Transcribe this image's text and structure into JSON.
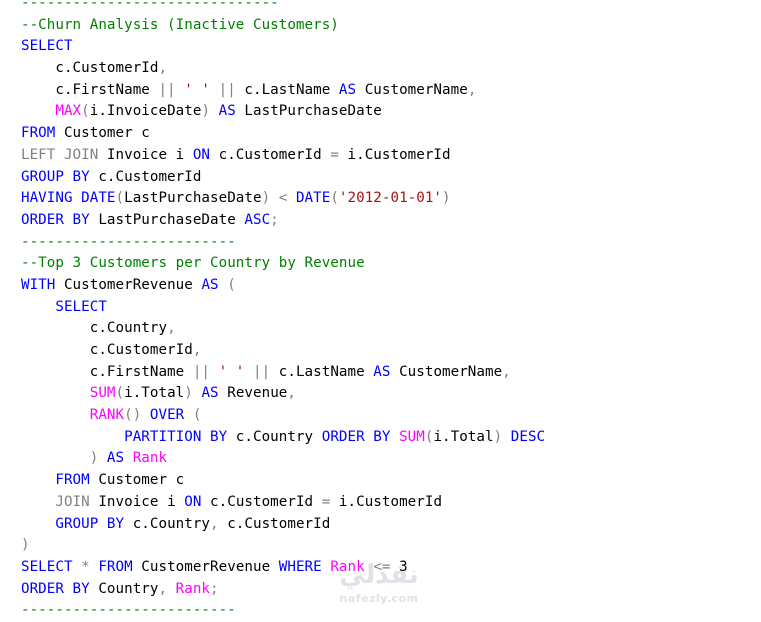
{
  "colors": {
    "comment": "#008000",
    "keyword": "#0000ff",
    "function": "#ff00ff",
    "string": "#a31515",
    "operator": "#808080",
    "text": "#000000"
  },
  "editor": {
    "lines": [
      [
        [
          "comment",
          "------------------------------"
        ]
      ],
      [
        [
          "comment",
          "--Churn Analysis (Inactive Customers)"
        ]
      ],
      [
        [
          "keyword",
          "SELECT"
        ]
      ],
      [
        [
          "text",
          "    c.CustomerId"
        ],
        [
          "operator",
          ","
        ]
      ],
      [
        [
          "text",
          "    c.FirstName "
        ],
        [
          "operator",
          "||"
        ],
        [
          "text",
          " "
        ],
        [
          "string",
          "' '"
        ],
        [
          "text",
          " "
        ],
        [
          "operator",
          "||"
        ],
        [
          "text",
          " c.LastName "
        ],
        [
          "keyword",
          "AS"
        ],
        [
          "text",
          " CustomerName"
        ],
        [
          "operator",
          ","
        ]
      ],
      [
        [
          "text",
          "    "
        ],
        [
          "function",
          "MAX"
        ],
        [
          "operator",
          "("
        ],
        [
          "text",
          "i.InvoiceDate"
        ],
        [
          "operator",
          ")"
        ],
        [
          "text",
          " "
        ],
        [
          "keyword",
          "AS"
        ],
        [
          "text",
          " LastPurchaseDate"
        ]
      ],
      [
        [
          "keyword",
          "FROM"
        ],
        [
          "text",
          " Customer c"
        ]
      ],
      [
        [
          "operator",
          "LEFT JOIN"
        ],
        [
          "text",
          " Invoice i "
        ],
        [
          "keyword",
          "ON"
        ],
        [
          "text",
          " c.CustomerId "
        ],
        [
          "operator",
          "="
        ],
        [
          "text",
          " i.CustomerId"
        ]
      ],
      [
        [
          "keyword",
          "GROUP BY"
        ],
        [
          "text",
          " c.CustomerId"
        ]
      ],
      [
        [
          "keyword",
          "HAVING DATE"
        ],
        [
          "operator",
          "("
        ],
        [
          "text",
          "LastPurchaseDate"
        ],
        [
          "operator",
          ")"
        ],
        [
          "text",
          " "
        ],
        [
          "operator",
          "<"
        ],
        [
          "text",
          " "
        ],
        [
          "keyword",
          "DATE"
        ],
        [
          "operator",
          "("
        ],
        [
          "string",
          "'2012-01-01'"
        ],
        [
          "operator",
          ")"
        ]
      ],
      [
        [
          "keyword",
          "ORDER BY"
        ],
        [
          "text",
          " LastPurchaseDate "
        ],
        [
          "keyword",
          "ASC"
        ],
        [
          "operator",
          ";"
        ]
      ],
      [
        [
          "comment",
          "-------------------------"
        ]
      ],
      [
        [
          "comment",
          "--Top 3 Customers per Country by Revenue"
        ]
      ],
      [
        [
          "keyword",
          "WITH"
        ],
        [
          "text",
          " CustomerRevenue "
        ],
        [
          "keyword",
          "AS"
        ],
        [
          "text",
          " "
        ],
        [
          "operator",
          "("
        ]
      ],
      [
        [
          "text",
          "    "
        ],
        [
          "keyword",
          "SELECT"
        ]
      ],
      [
        [
          "text",
          "        c.Country"
        ],
        [
          "operator",
          ","
        ]
      ],
      [
        [
          "text",
          "        c.CustomerId"
        ],
        [
          "operator",
          ","
        ]
      ],
      [
        [
          "text",
          "        c.FirstName "
        ],
        [
          "operator",
          "||"
        ],
        [
          "text",
          " "
        ],
        [
          "string",
          "' '"
        ],
        [
          "text",
          " "
        ],
        [
          "operator",
          "||"
        ],
        [
          "text",
          " c.LastName "
        ],
        [
          "keyword",
          "AS"
        ],
        [
          "text",
          " CustomerName"
        ],
        [
          "operator",
          ","
        ]
      ],
      [
        [
          "text",
          "        "
        ],
        [
          "function",
          "SUM"
        ],
        [
          "operator",
          "("
        ],
        [
          "text",
          "i.Total"
        ],
        [
          "operator",
          ")"
        ],
        [
          "text",
          " "
        ],
        [
          "keyword",
          "AS"
        ],
        [
          "text",
          " Revenue"
        ],
        [
          "operator",
          ","
        ]
      ],
      [
        [
          "text",
          "        "
        ],
        [
          "function",
          "RANK"
        ],
        [
          "operator",
          "()"
        ],
        [
          "text",
          " "
        ],
        [
          "keyword",
          "OVER"
        ],
        [
          "text",
          " "
        ],
        [
          "operator",
          "("
        ]
      ],
      [
        [
          "text",
          "            "
        ],
        [
          "keyword",
          "PARTITION BY"
        ],
        [
          "text",
          " c.Country "
        ],
        [
          "keyword",
          "ORDER BY"
        ],
        [
          "text",
          " "
        ],
        [
          "function",
          "SUM"
        ],
        [
          "operator",
          "("
        ],
        [
          "text",
          "i.Total"
        ],
        [
          "operator",
          ")"
        ],
        [
          "text",
          " "
        ],
        [
          "keyword",
          "DESC"
        ]
      ],
      [
        [
          "text",
          "        "
        ],
        [
          "operator",
          ")"
        ],
        [
          "text",
          " "
        ],
        [
          "keyword",
          "AS"
        ],
        [
          "text",
          " "
        ],
        [
          "function",
          "Rank"
        ]
      ],
      [
        [
          "text",
          "    "
        ],
        [
          "keyword",
          "FROM"
        ],
        [
          "text",
          " Customer c"
        ]
      ],
      [
        [
          "text",
          "    "
        ],
        [
          "operator",
          "JOIN"
        ],
        [
          "text",
          " Invoice i "
        ],
        [
          "keyword",
          "ON"
        ],
        [
          "text",
          " c.CustomerId "
        ],
        [
          "operator",
          "="
        ],
        [
          "text",
          " i.CustomerId"
        ]
      ],
      [
        [
          "text",
          "    "
        ],
        [
          "keyword",
          "GROUP BY"
        ],
        [
          "text",
          " c.Country"
        ],
        [
          "operator",
          ","
        ],
        [
          "text",
          " c.CustomerId"
        ]
      ],
      [
        [
          "operator",
          ")"
        ]
      ],
      [
        [
          "keyword",
          "SELECT"
        ],
        [
          "text",
          " "
        ],
        [
          "operator",
          "*"
        ],
        [
          "text",
          " "
        ],
        [
          "keyword",
          "FROM"
        ],
        [
          "text",
          " CustomerRevenue "
        ],
        [
          "keyword",
          "WHERE"
        ],
        [
          "text",
          " "
        ],
        [
          "function",
          "Rank"
        ],
        [
          "text",
          " "
        ],
        [
          "operator",
          "<="
        ],
        [
          "text",
          " 3"
        ]
      ],
      [
        [
          "keyword",
          "ORDER BY"
        ],
        [
          "text",
          " Country"
        ],
        [
          "operator",
          ","
        ],
        [
          "text",
          " "
        ],
        [
          "function",
          "Rank"
        ],
        [
          "operator",
          ";"
        ]
      ],
      [
        [
          "comment",
          "-------------------------"
        ]
      ]
    ]
  },
  "watermark": {
    "glyphs": "نفذلي",
    "text": "nafezly.com"
  }
}
